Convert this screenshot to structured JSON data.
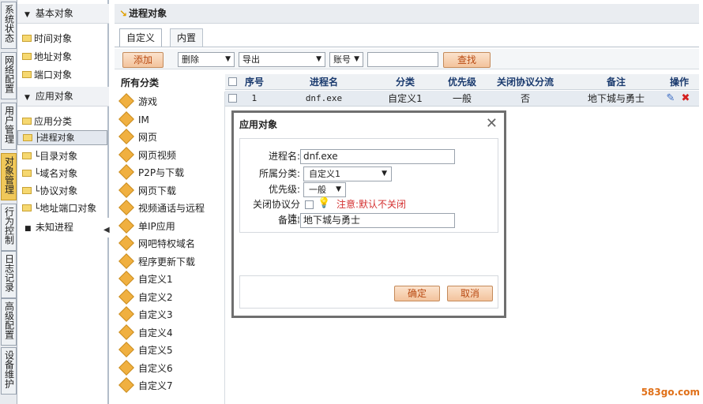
{
  "vtabs": [
    "系统状态",
    "网络配置",
    "用户管理",
    "对象管理",
    "行为控制",
    "日志记录",
    "高级配置",
    "设备维护"
  ],
  "tree": {
    "group1": "基本对象",
    "items1": [
      "时间对象",
      "地址对象",
      "端口对象"
    ],
    "group2": "应用对象",
    "items2": [
      "应用分类",
      "├进程对象",
      "└目录对象",
      "└域名对象",
      "└协议对象",
      "└地址端口对象"
    ],
    "group3": "未知进程",
    "collapse": "◀"
  },
  "header": {
    "title": "进程对象"
  },
  "tabs": [
    "自定义",
    "内置"
  ],
  "toolbar": {
    "add": "添加",
    "delete": "删除",
    "export": "导出",
    "account": "账号",
    "find": "查找"
  },
  "categories": {
    "title": "所有分类",
    "items": [
      "游戏",
      "IM",
      "网页",
      "网页视频",
      "P2P与下载",
      "网页下载",
      "视频通话与远程",
      "单IP应用",
      "网吧特权域名",
      "程序更新下载",
      "自定义1",
      "自定义2",
      "自定义3",
      "自定义4",
      "自定义5",
      "自定义6",
      "自定义7"
    ]
  },
  "grid": {
    "headers": [
      "序号",
      "进程名",
      "分类",
      "优先级",
      "关闭协议分流",
      "备注",
      "操作"
    ],
    "row": {
      "index": "1",
      "process": "dnf.exe",
      "category": "自定义1",
      "priority": "一般",
      "close": "否",
      "note": "地下城与勇士"
    }
  },
  "dialog": {
    "title": "应用对象",
    "close": "✕",
    "process_label": "进程名:",
    "process_value": "dnf.exe",
    "category_label": "所属分类:",
    "category_value": "自定义1",
    "priority_label": "优先级:",
    "priority_value": "一般",
    "close_label": "关闭协议分流:",
    "close_note": "注意:默认不关闭",
    "note_label": "备注:",
    "note_value": "地下城与勇士",
    "ok": "确定",
    "cancel": "取消"
  },
  "watermark": "583go.com",
  "colors": {
    "accent": "#f0c85a",
    "button_text": "#b94a12",
    "note_red": "#d43030"
  }
}
